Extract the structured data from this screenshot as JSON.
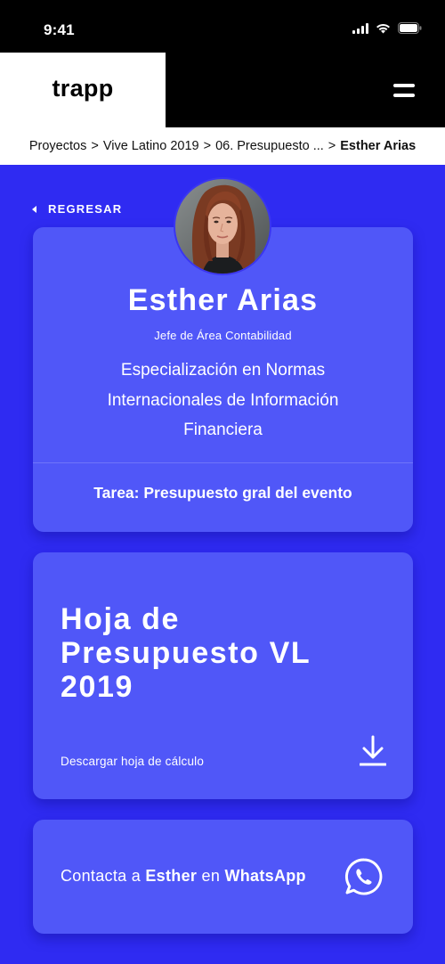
{
  "status_bar": {
    "time": "9:41"
  },
  "header": {
    "logo": "trapp",
    "menu_icon": "hamburger-menu-icon"
  },
  "breadcrumb": {
    "items": [
      "Proyectos",
      "Vive Latino 2019",
      "06. Presupuesto ..."
    ],
    "separator": ">",
    "current": "Esther Arias"
  },
  "back": {
    "label": "REGRESAR",
    "icon": "caret-left-icon"
  },
  "profile": {
    "name": "Esther Arias",
    "role": "Jefe de Área Contabilidad",
    "specialization": "Especialización en Normas Internacionales de Información Financiera",
    "task": "Tarea: Presupuesto gral del evento"
  },
  "document": {
    "title": "Hoja de Presupuesto VL 2019",
    "link": "Descargar hoja de cálculo",
    "icon": "download-icon"
  },
  "contact": {
    "prefix": "Contacta a",
    "name": "Esther",
    "middle": "en",
    "channel": "WhatsApp",
    "icon": "whatsapp-icon"
  },
  "colors": {
    "background": "#2f2bf2",
    "card": "#5057f8",
    "header": "#000000",
    "text": "#ffffff"
  }
}
